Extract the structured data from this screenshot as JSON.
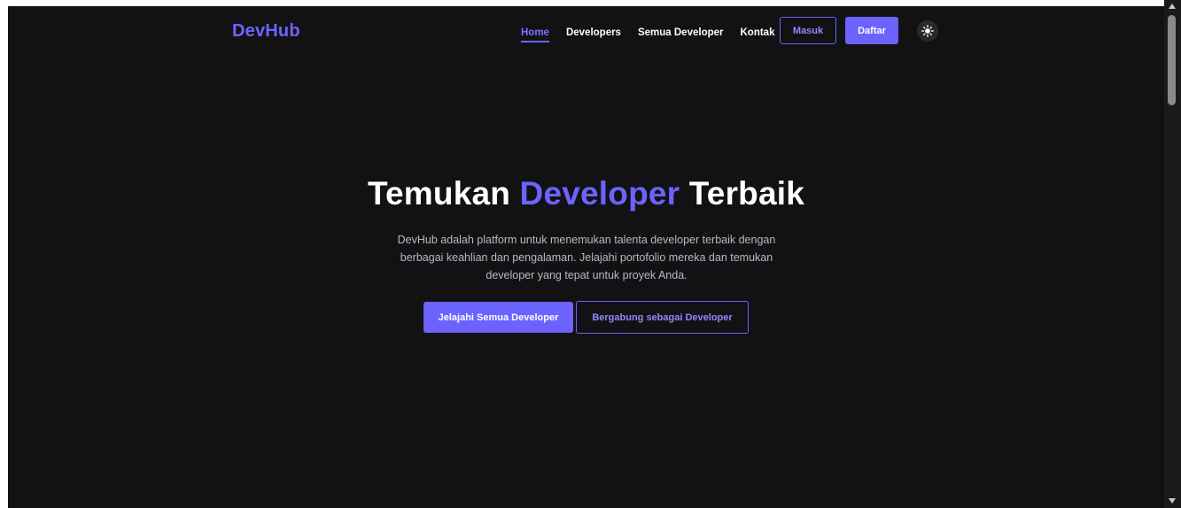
{
  "navbar": {
    "brand": "DevHub",
    "links": [
      {
        "label": "Home",
        "active": true
      },
      {
        "label": "Developers",
        "active": false
      },
      {
        "label": "Semua Developer",
        "active": false
      },
      {
        "label": "Kontak",
        "active": false
      }
    ],
    "login_label": "Masuk",
    "register_label": "Daftar",
    "theme_icon": "sun-icon"
  },
  "hero": {
    "title_start": "Temukan ",
    "title_accent": "Developer",
    "title_end": " Terbaik",
    "description": "DevHub adalah platform untuk menemukan talenta developer terbaik dengan berbagai keahlian dan pengalaman. Jelajahi portofolio mereka dan temukan developer yang tepat untuk proyek Anda.",
    "primary_button": "Jelajahi Semua Developer",
    "secondary_button": "Bergabung sebagai Developer"
  },
  "colors": {
    "accent": "#6c63ff",
    "background": "#121214",
    "text": "#ffffff",
    "muted_text": "#b9b9c2"
  }
}
